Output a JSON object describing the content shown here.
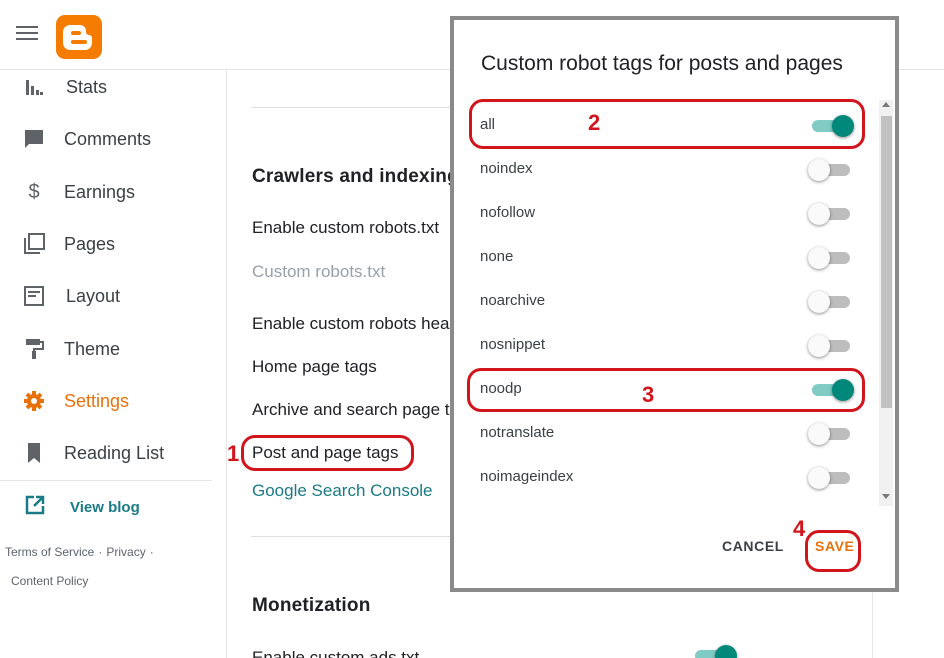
{
  "sidebar": {
    "items": [
      {
        "label": "Stats",
        "icon": "stats-icon"
      },
      {
        "label": "Comments",
        "icon": "comment-icon"
      },
      {
        "label": "Earnings",
        "icon": "dollar-icon"
      },
      {
        "label": "Pages",
        "icon": "pages-icon"
      },
      {
        "label": "Layout",
        "icon": "layout-icon"
      },
      {
        "label": "Theme",
        "icon": "paint-roller-icon"
      },
      {
        "label": "Settings",
        "icon": "gear-icon",
        "active": true
      },
      {
        "label": "Reading List",
        "icon": "bookmark-icon"
      }
    ],
    "view_blog": "View blog",
    "footer": {
      "terms": "Terms of Service",
      "privacy": "Privacy",
      "content_policy": "Content Policy",
      "separator": "·"
    }
  },
  "main": {
    "crawlers_title": "Crawlers and indexing",
    "settings": {
      "enable_robots_txt": "Enable custom robots.txt",
      "custom_robots_txt": "Custom robots.txt",
      "enable_robots_header": "Enable custom robots header tags",
      "home_page_tags": "Home page tags",
      "archive_search_tags": "Archive and search page tags",
      "post_page_tags": "Post and page tags",
      "search_console": "Google Search Console"
    },
    "monetization_title": "Monetization",
    "enable_ads_txt": "Enable custom ads.txt"
  },
  "dialog": {
    "title": "Custom robot tags for posts and pages",
    "tags": [
      {
        "label": "all",
        "on": true
      },
      {
        "label": "noindex",
        "on": false
      },
      {
        "label": "nofollow",
        "on": false
      },
      {
        "label": "none",
        "on": false
      },
      {
        "label": "noarchive",
        "on": false
      },
      {
        "label": "nosnippet",
        "on": false
      },
      {
        "label": "noodp",
        "on": true
      },
      {
        "label": "notranslate",
        "on": false
      },
      {
        "label": "noimageindex",
        "on": false
      }
    ],
    "cancel_label": "CANCEL",
    "save_label": "SAVE"
  },
  "annotations": [
    "1",
    "2",
    "3",
    "4"
  ],
  "colors": {
    "accent": "#e8710a",
    "blogger_orange": "#f57c00",
    "toggle_on": "#00897b",
    "link": "#1a7a85",
    "annotation_red": "#d0151c"
  }
}
